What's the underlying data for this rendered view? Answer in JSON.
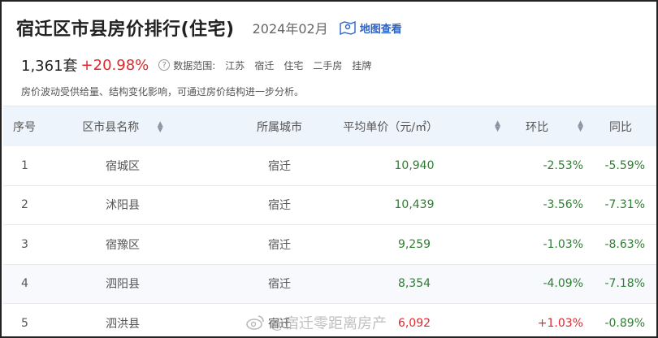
{
  "header": {
    "title": "宿迁区市县房价排行(住宅)",
    "date": "2024年02月",
    "map_link": "地图查看"
  },
  "stats": {
    "count": "1,361套",
    "change": "+20.98%",
    "scope_label": "数据范围:",
    "tags": [
      "江苏",
      "宿迁",
      "住宅",
      "二手房",
      "挂牌"
    ]
  },
  "note": "房价波动受供给量、结构变化影响，可通过房价结构进一步分析。",
  "table": {
    "columns": [
      "序号",
      "区市县名称",
      "所属城市",
      "平均单价（元/㎡）",
      "环比",
      "同比"
    ],
    "rows": [
      {
        "rank": "1",
        "name": "宿城区",
        "city": "宿迁",
        "price": "10,940",
        "mom": "-2.53%",
        "yoy": "-5.59%"
      },
      {
        "rank": "2",
        "name": "沭阳县",
        "city": "宿迁",
        "price": "10,439",
        "mom": "-3.56%",
        "yoy": "-7.31%"
      },
      {
        "rank": "3",
        "name": "宿豫区",
        "city": "宿迁",
        "price": "9,259",
        "mom": "-1.03%",
        "yoy": "-8.63%"
      },
      {
        "rank": "4",
        "name": "泗阳县",
        "city": "宿迁",
        "price": "8,354",
        "mom": "-4.09%",
        "yoy": "-7.18%"
      },
      {
        "rank": "5",
        "name": "泗洪县",
        "city": "宿迁",
        "price": "6,092",
        "mom": "+1.03%",
        "yoy": "-0.89%"
      }
    ]
  },
  "watermark": "@宿迁零距离房产",
  "colors": {
    "accent": "#2b63c7",
    "up": "#e0282e",
    "down": "#2f7d32",
    "header_bg": "#eef4fb"
  }
}
